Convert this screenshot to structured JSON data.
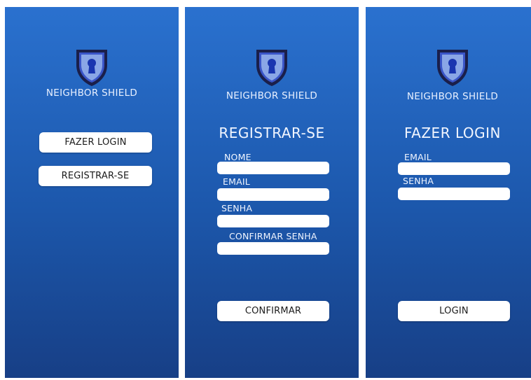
{
  "brand": {
    "name": "NEIGHBOR SHIELD"
  },
  "home": {
    "login_button": "FAZER LOGIN",
    "register_button": "REGISTRAR-SE"
  },
  "register": {
    "title": "REGISTRAR-SE",
    "name_label": "NOME",
    "email_label": "EMAIL",
    "password_label": "SENHA",
    "confirm_password_label": "CONFIRMAR SENHA",
    "confirm_button": "CONFIRMAR"
  },
  "login": {
    "title": "FAZER LOGIN",
    "email_label": "EMAIL",
    "password_label": "SENHA",
    "login_button": "LOGIN"
  },
  "colors": {
    "background_top": "#2a71cf",
    "background_bottom": "#173f86",
    "shield_dark": "#1a1f4a",
    "shield_inner": "#6f8fd8",
    "keyhole": "#1a35b0"
  }
}
